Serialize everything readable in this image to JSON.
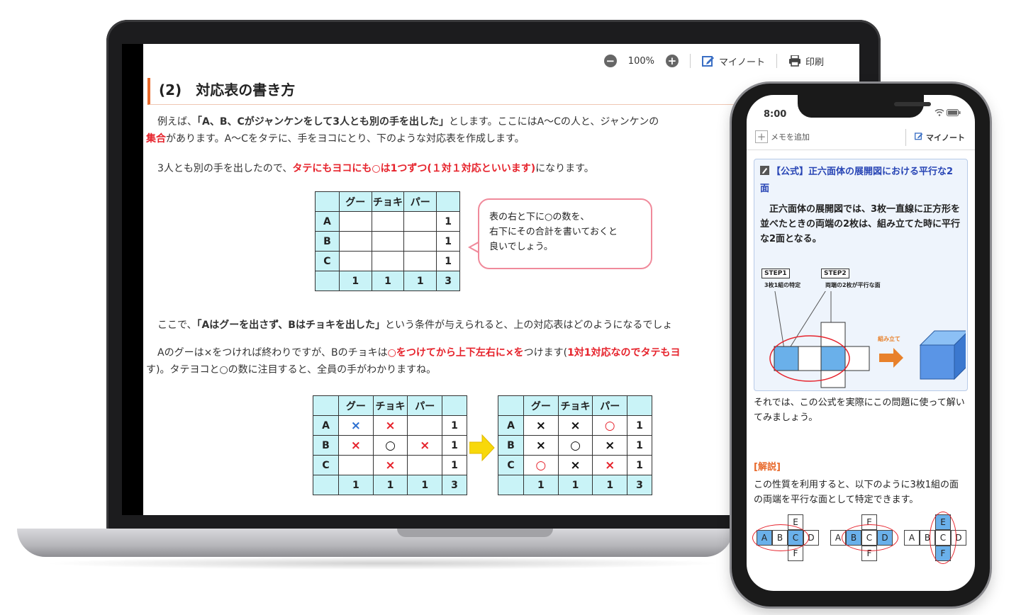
{
  "laptop": {
    "toolbar": {
      "zoom_out_label": "−",
      "zoom_level": "100%",
      "zoom_in_label": "+",
      "mynote_label": "マイノート",
      "print_label": "印刷"
    },
    "title": "(2)　対応表の書き方",
    "para1": {
      "a": "例えば、",
      "b": "「A、B、Cがジャンケンをして3人とも別の手を出した」",
      "c": "とします。ここにはA～Cの人と、ジャンケンの",
      "d": "集合",
      "e": "があります。A～Cをタテに、手をヨコにとり、下のような対応表を作成します。"
    },
    "para2": {
      "a": "3人とも別の手を出したので、",
      "b": "タテにもヨコにも○は1つずつ(１対１対応といいます)",
      "c": "になります。"
    },
    "table1": {
      "header": [
        "",
        "グー",
        "チョキ",
        "パー",
        ""
      ],
      "rows": [
        [
          "A",
          "",
          "",
          "",
          "1"
        ],
        [
          "B",
          "",
          "",
          "",
          "1"
        ],
        [
          "C",
          "",
          "",
          "",
          "1"
        ],
        [
          "",
          "1",
          "1",
          "1",
          "3"
        ]
      ]
    },
    "bubble": [
      "表の右と下に○の数を、",
      "右下にその合計を書いておくと",
      "良いでしょう。"
    ],
    "para3": {
      "a": "ここで、",
      "b": "「Aはグーを出さず、Bはチョキを出した」",
      "c": "という条件が与えられると、上の対応表はどのようになるでしょ"
    },
    "para4": {
      "a": "Aのグーは×をつければ終わりですが、Bのチョキは",
      "b": "○をつけてから上下左右に×を",
      "c": "つけます(",
      "d": "1対1対応なのでタテもヨ",
      "e": "す)。タテヨコと○の数に注目すると、全員の手がわかりますね。"
    },
    "table2": {
      "header": [
        "",
        "グー",
        "チョキ",
        "パー",
        ""
      ],
      "rows": [
        [
          "A",
          "×",
          "×",
          "",
          "1"
        ],
        [
          "B",
          "×",
          "○",
          "×",
          "1"
        ],
        [
          "C",
          "",
          "×",
          "",
          "1"
        ],
        [
          "",
          "1",
          "1",
          "1",
          "3"
        ]
      ]
    },
    "table3": {
      "header": [
        "",
        "グー",
        "チョキ",
        "パー",
        ""
      ],
      "rows": [
        [
          "A",
          "×",
          "×",
          "○",
          "1"
        ],
        [
          "B",
          "×",
          "○",
          "×",
          "1"
        ],
        [
          "C",
          "○",
          "×",
          "×",
          "1"
        ],
        [
          "",
          "1",
          "1",
          "1",
          "3"
        ]
      ]
    }
  },
  "phone": {
    "time": "8:00",
    "memo_label": "メモを追加",
    "mynote_label": "マイノート",
    "formula_title": "【公式】正六面体の展開図における平行な2面",
    "formula_text": "正六面体の展開図では、3枚一直線に正方形を並べたときの両端の2枚は、組み立てた時に平行な2面となる。",
    "step1": "STEP1",
    "step1_sub": "3枚1組の特定",
    "step2": "STEP2",
    "step2_sub": "両端の2枚が平行な面",
    "assemble_label": "組み立て",
    "text1": "それでは、この公式を実際にこの問題に使って解いてみましょう。",
    "kaisetsu": "[解説]",
    "text2": "この性質を利用すると、以下のように3枚1組の面の両端を平行な面として特定できます。",
    "net_letters": [
      "A",
      "B",
      "C",
      "D",
      "E",
      "F"
    ]
  }
}
